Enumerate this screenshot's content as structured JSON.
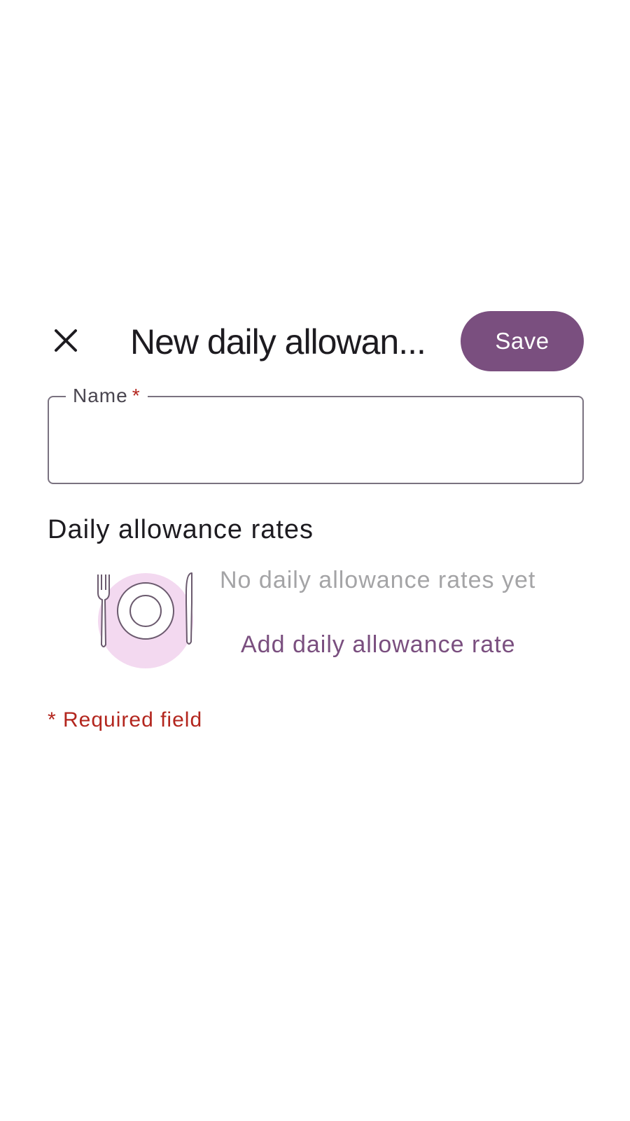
{
  "header": {
    "close_icon": "close-icon",
    "title": "New daily allowan...",
    "save_label": "Save"
  },
  "form": {
    "name_label": "Name",
    "name_required_marker": "*",
    "name_value": ""
  },
  "rates_section": {
    "title": "Daily allowance rates",
    "empty_icon": "plate-cutlery-icon",
    "empty_text": "No daily allowance rates yet",
    "add_label": "Add daily allowance rate"
  },
  "footer": {
    "required_note": "* Required field"
  },
  "colors": {
    "accent": "#7a4f7f",
    "required": "#b3261e",
    "illustration_bg": "#f3d9f0"
  }
}
